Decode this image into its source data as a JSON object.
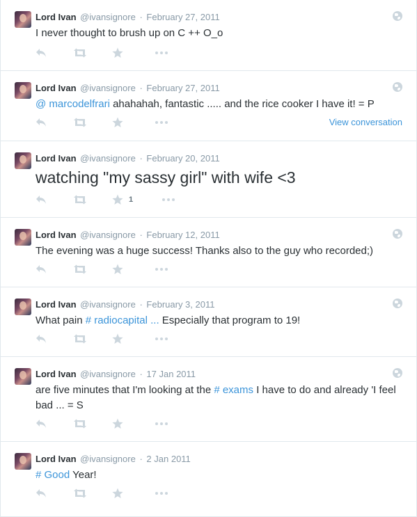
{
  "tweets": [
    {
      "name": "Lord Ivan",
      "handle": "@ivansignore",
      "date": "February 27, 2011",
      "text": "I never thought to brush up on C ++ O_o"
    },
    {
      "name": "Lord Ivan",
      "handle": "@ivansignore",
      "date": "February 27, 2011",
      "mention": "@ marcodelfrari",
      "text": " ahahahah, fantastic ..... and the rice cooker I have it! = P",
      "view_conversation": "View conversation"
    },
    {
      "name": "Lord Ivan",
      "handle": "@ivansignore",
      "date": "February 20, 2011",
      "text": "watching \"my sassy girl\" with wife <3",
      "favorite_count": "1"
    },
    {
      "name": "Lord Ivan",
      "handle": "@ivansignore",
      "date": "February 12, 2011",
      "text": "The evening was a huge success! Thanks also to the guy who recorded;)"
    },
    {
      "name": "Lord Ivan",
      "handle": "@ivansignore",
      "date": "February 3, 2011",
      "text_before": "What pain ",
      "hashtag": "# radiocapital ...",
      "text_after": " Especially that program to 19!"
    },
    {
      "name": "Lord Ivan",
      "handle": "@ivansignore",
      "date": "17 Jan 2011",
      "text_before": "are five minutes that I'm looking at the ",
      "hashtag": "# exams",
      "text_after": " I have to do and already 'I feel bad ... = S"
    },
    {
      "name": "Lord Ivan",
      "handle": "@ivansignore",
      "date": "2 Jan 2011",
      "hashtag": "# Good",
      "text_after": " Year!"
    }
  ],
  "separator": "·",
  "icons": {
    "reply": "reply-icon",
    "retweet": "retweet-icon",
    "favorite": "star-icon",
    "more": "more-icon",
    "globe": "globe-icon"
  },
  "colors": {
    "link": "#3b94d9",
    "muted": "#8899a6",
    "icon": "#ccd6dd",
    "text": "#292f33"
  }
}
